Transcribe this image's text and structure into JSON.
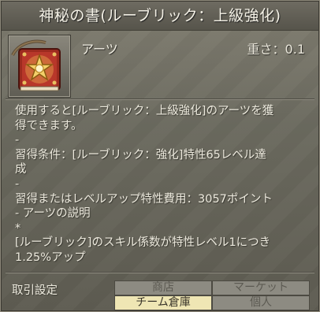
{
  "item": {
    "name": "神秘の書(ルーブリック：上級強化)",
    "type": "アーツ",
    "weight": "重さ：0.1",
    "icon": "mystic-book-icon"
  },
  "description": {
    "lines": [
      "使用すると[ルーブリック：上級強化]のアーツを獲",
      "得できます。",
      "-",
      "習得条件：[ルーブリック：強化]特性65レベル達",
      "成",
      "-",
      "習得またはレベルアップ特性費用：3057ポイント",
      "- アーツの説明",
      "*",
      "[ルーブリック]のスキル係数が特性レベル1につき",
      "1.25%アップ"
    ]
  },
  "trade": {
    "label": "取引設定",
    "options": [
      {
        "label": "商店",
        "enabled": false
      },
      {
        "label": "マーケット",
        "enabled": false
      },
      {
        "label": "チーム倉庫",
        "enabled": true
      },
      {
        "label": "個人",
        "enabled": false
      }
    ]
  },
  "colors": {
    "enabled_cell": "#efe6b4",
    "disabled_cell": "#8d8b82",
    "text": "#ece9dd"
  }
}
